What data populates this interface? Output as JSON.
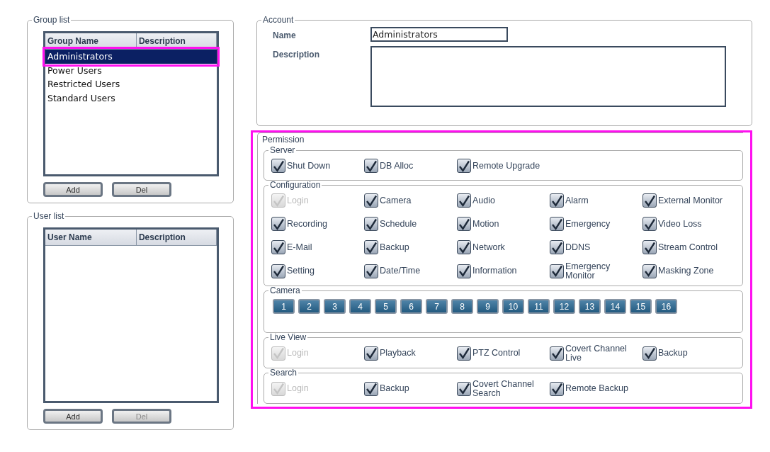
{
  "group_list": {
    "title": "Group list",
    "columns": [
      "Group Name",
      "Description"
    ],
    "rows": [
      {
        "name": "Administrators",
        "selected": true,
        "highlighted": true
      },
      {
        "name": "Power Users",
        "selected": false,
        "highlighted": false
      },
      {
        "name": "Restricted Users",
        "selected": false,
        "highlighted": false
      },
      {
        "name": "Standard Users",
        "selected": false,
        "highlighted": false
      }
    ],
    "buttons": [
      {
        "label": "Add",
        "disabled": false
      },
      {
        "label": "Del",
        "disabled": false
      }
    ]
  },
  "user_list": {
    "title": "User list",
    "columns": [
      "User Name",
      "Description"
    ],
    "buttons": [
      {
        "label": "Add",
        "disabled": false
      },
      {
        "label": "Del",
        "disabled": true
      }
    ]
  },
  "account": {
    "title": "Account",
    "fields": [
      {
        "kind": "input",
        "label": "Name",
        "value": "Administrators"
      },
      {
        "kind": "textarea",
        "label": "Description"
      }
    ]
  },
  "permission": {
    "title": "Permission",
    "highlighted": true,
    "sections": [
      {
        "kind": "checkboxes",
        "title": "Server",
        "items": [
          {
            "label": "Shut Down",
            "checked": true,
            "disabled": false
          },
          {
            "label": "DB Alloc",
            "checked": true,
            "disabled": false
          },
          {
            "label": "Remote Upgrade",
            "checked": true,
            "disabled": false
          }
        ]
      },
      {
        "kind": "checkboxes",
        "title": "Configuration",
        "items": [
          {
            "label": "Login",
            "checked": true,
            "disabled": true
          },
          {
            "label": "Camera",
            "checked": true,
            "disabled": false
          },
          {
            "label": "Audio",
            "checked": true,
            "disabled": false
          },
          {
            "label": "Alarm",
            "checked": true,
            "disabled": false
          },
          {
            "label": "External Monitor",
            "checked": true,
            "disabled": false
          },
          {
            "label": "Recording",
            "checked": true,
            "disabled": false
          },
          {
            "label": "Schedule",
            "checked": true,
            "disabled": false
          },
          {
            "label": "Motion",
            "checked": true,
            "disabled": false
          },
          {
            "label": "Emergency",
            "checked": true,
            "disabled": false
          },
          {
            "label": "Video Loss",
            "checked": true,
            "disabled": false
          },
          {
            "label": "E-Mail",
            "checked": true,
            "disabled": false
          },
          {
            "label": "Backup",
            "checked": true,
            "disabled": false
          },
          {
            "label": "Network",
            "checked": true,
            "disabled": false
          },
          {
            "label": "DDNS",
            "checked": true,
            "disabled": false
          },
          {
            "label": "Stream Control",
            "checked": true,
            "disabled": false
          },
          {
            "label": "Setting",
            "checked": true,
            "disabled": false
          },
          {
            "label": "Date/Time",
            "checked": true,
            "disabled": false
          },
          {
            "label": "Information",
            "checked": true,
            "disabled": false
          },
          {
            "label": "Emergency\nMonitor",
            "checked": true,
            "disabled": false
          },
          {
            "label": "Masking Zone",
            "checked": true,
            "disabled": false
          }
        ]
      },
      {
        "kind": "channels",
        "title": "Camera",
        "channels": [
          {
            "label": "1",
            "selected": true
          },
          {
            "label": "2",
            "selected": true
          },
          {
            "label": "3",
            "selected": true
          },
          {
            "label": "4",
            "selected": true
          },
          {
            "label": "5",
            "selected": true
          },
          {
            "label": "6",
            "selected": true
          },
          {
            "label": "7",
            "selected": true
          },
          {
            "label": "8",
            "selected": true
          },
          {
            "label": "9",
            "selected": true
          },
          {
            "label": "10",
            "selected": true
          },
          {
            "label": "11",
            "selected": true
          },
          {
            "label": "12",
            "selected": true
          },
          {
            "label": "13",
            "selected": true
          },
          {
            "label": "14",
            "selected": true
          },
          {
            "label": "15",
            "selected": true
          },
          {
            "label": "16",
            "selected": true
          }
        ]
      },
      {
        "kind": "checkboxes",
        "title": "Live View",
        "items": [
          {
            "label": "Login",
            "checked": true,
            "disabled": true
          },
          {
            "label": "Playback",
            "checked": true,
            "disabled": false
          },
          {
            "label": "PTZ Control",
            "checked": true,
            "disabled": false
          },
          {
            "label": "Covert Channel\nLive",
            "checked": true,
            "disabled": false
          },
          {
            "label": "Backup",
            "checked": true,
            "disabled": false
          }
        ]
      },
      {
        "kind": "checkboxes",
        "title": "Search",
        "items": [
          {
            "label": "Login",
            "checked": true,
            "disabled": true
          },
          {
            "label": "Backup",
            "checked": true,
            "disabled": false
          },
          {
            "label": "Covert Channel\nSearch",
            "checked": true,
            "disabled": false
          },
          {
            "label": "Remote Backup",
            "checked": true,
            "disabled": false
          }
        ]
      }
    ]
  }
}
